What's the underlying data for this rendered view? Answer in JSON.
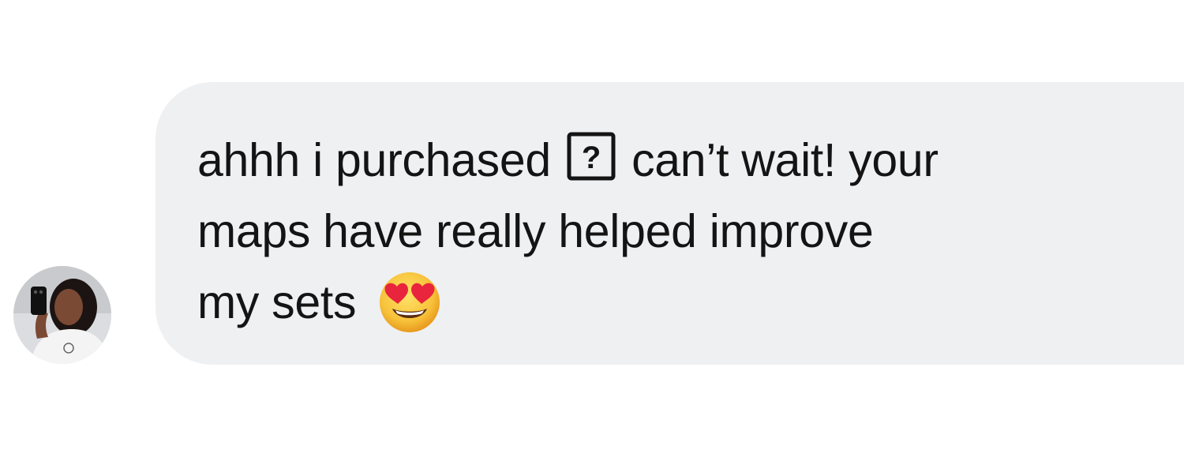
{
  "message": {
    "line1_before": "ahhh i purchased",
    "line1_after": "can’t wait! your",
    "line2": "maps have really helped improve",
    "line3": "my sets"
  },
  "icons": {
    "missing_glyph": "missing-character-box-icon",
    "emoji": "smiling-face-with-heart-eyes-emoji"
  },
  "colors": {
    "bubble": "#eff0f2",
    "text": "#141414",
    "background": "#ffffff"
  }
}
